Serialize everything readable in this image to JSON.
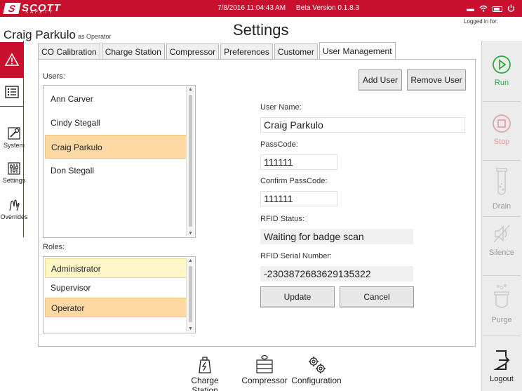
{
  "topbar": {
    "brand": "SCOTT",
    "brand_sub": "SAFETY",
    "datetime": "7/8/2016 11:04:43 AM",
    "version": "Beta Version 0.1.8.3",
    "icons": [
      "minimize-icon",
      "wifi-icon",
      "battery-icon",
      "power-icon"
    ]
  },
  "header": {
    "user_name": "Craig Parkulo",
    "user_role": "as Operator",
    "title": "Settings",
    "logged_in": "Logged in for:"
  },
  "left_nav": {
    "items": [
      {
        "label": "",
        "icon": "warning-icon"
      },
      {
        "label": "",
        "icon": "list-icon"
      },
      {
        "label": "System",
        "icon": "wrench-icon"
      },
      {
        "label": "Settings",
        "icon": "sliders-icon"
      },
      {
        "label": "Overrides",
        "icon": "hand-icon"
      }
    ]
  },
  "right_nav": {
    "items": [
      {
        "label": "Run",
        "icon": "play-icon",
        "enabled": true
      },
      {
        "label": "Stop",
        "icon": "stop-icon",
        "enabled": false
      },
      {
        "label": "Drain",
        "icon": "test-tube-icon",
        "enabled": false
      },
      {
        "label": "Silence",
        "icon": "mute-icon",
        "enabled": false
      },
      {
        "label": "Purge",
        "icon": "cup-icon",
        "enabled": false
      },
      {
        "label": "Logout",
        "icon": "logout-icon",
        "enabled": true
      }
    ],
    "colors": {
      "run": "#2eaa3f",
      "disabled": "#e3a3a3",
      "disabled_text": "#999999"
    }
  },
  "tabs": [
    {
      "label": "CO Calibration",
      "active": false
    },
    {
      "label": "Charge Station",
      "active": false
    },
    {
      "label": "Compressor",
      "active": false
    },
    {
      "label": "Preferences",
      "active": false
    },
    {
      "label": "Customer",
      "active": false
    },
    {
      "label": "User Management",
      "active": true
    }
  ],
  "users": {
    "label": "Users:",
    "items": [
      "Ann Carver",
      "Cindy Stegall",
      "Craig Parkulo",
      "Don Stegall"
    ],
    "selected": "Craig Parkulo"
  },
  "roles": {
    "label": "Roles:",
    "items": [
      "Administrator",
      "Supervisor",
      "Operator"
    ],
    "selected": "Operator",
    "highlighted": "Administrator"
  },
  "actions": {
    "add_user": "Add User",
    "remove_user": "Remove User"
  },
  "form": {
    "user_name_label": "User Name:",
    "user_name_value": "Craig Parkulo",
    "passcode_label": "PassCode:",
    "passcode_value": "111111",
    "confirm_label": "Confirm PassCode:",
    "confirm_value": "111111",
    "rfid_status_label": "RFID Status:",
    "rfid_status_value": "Waiting for badge scan",
    "rfid_serial_label": "RFID Serial Number:",
    "rfid_serial_value": "-2303872683629135322",
    "update": "Update",
    "cancel": "Cancel"
  },
  "bottom_nav": {
    "items": [
      {
        "label": "Charge Station",
        "icon": "charge-station-icon"
      },
      {
        "label": "Compressor",
        "icon": "compressor-icon"
      },
      {
        "label": "Configuration",
        "icon": "gears-icon"
      }
    ]
  },
  "colors": {
    "brand_red": "#c8102e",
    "selection": "#fcd9a3",
    "highlight": "#fff7c8"
  }
}
